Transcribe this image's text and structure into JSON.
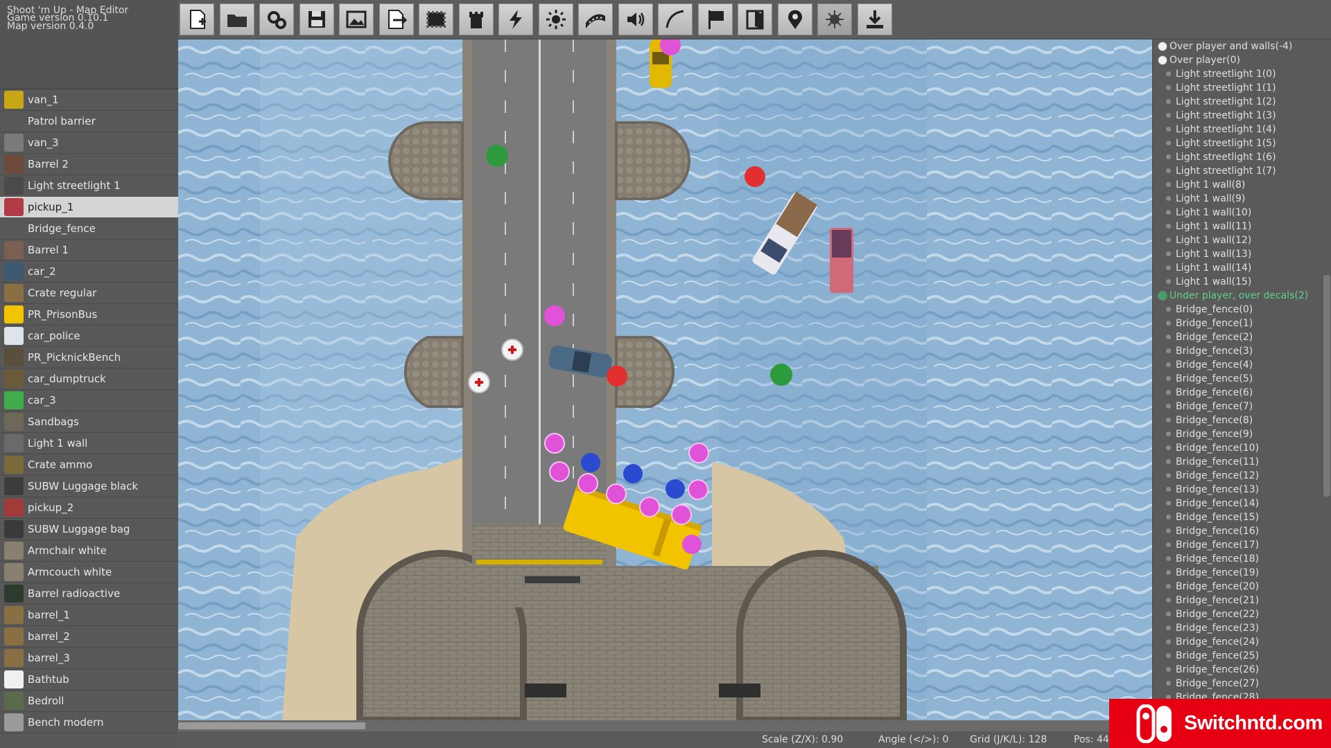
{
  "info": {
    "title": "Shoot 'm Up - Map Editor",
    "game_version": "Game version 0.10.1",
    "map_version": "Map version 0.4.0"
  },
  "toolbar": {
    "buttons": [
      {
        "name": "new-map",
        "icon": "new-file-icon"
      },
      {
        "name": "open-map",
        "icon": "folder-icon"
      },
      {
        "name": "settings",
        "icon": "gears-icon"
      },
      {
        "name": "save-map",
        "icon": "floppy-icon"
      },
      {
        "name": "background-image",
        "icon": "image-icon"
      },
      {
        "name": "export",
        "icon": "export-icon"
      },
      {
        "name": "stamp-tool",
        "icon": "stamp-icon"
      },
      {
        "name": "tower-tool",
        "icon": "tower-icon"
      },
      {
        "name": "lightning-tool",
        "icon": "lightning-icon"
      },
      {
        "name": "light-tool",
        "icon": "sun-icon"
      },
      {
        "name": "path-tool",
        "icon": "road-icon"
      },
      {
        "name": "sound-tool",
        "icon": "speaker-icon"
      },
      {
        "name": "curve-tool",
        "icon": "curve-icon"
      },
      {
        "name": "flag-tool",
        "icon": "flag-icon"
      },
      {
        "name": "door-tool",
        "icon": "door-icon"
      },
      {
        "name": "waypoint-tool",
        "icon": "map-pin-icon"
      },
      {
        "name": "effect-tool",
        "icon": "splat-icon"
      },
      {
        "name": "import-tool",
        "icon": "download-icon"
      }
    ]
  },
  "objects": [
    {
      "label": "van_1",
      "color": "#c9a616"
    },
    {
      "label": "Patrol barrier",
      "color": "#585858"
    },
    {
      "label": "van_3",
      "color": "#7a7a7a"
    },
    {
      "label": "Barrel 2",
      "color": "#6e4a3c"
    },
    {
      "label": "Light streetlight 1",
      "color": "#4a4a4a"
    },
    {
      "label": "pickup_1",
      "color": "#b13c48",
      "selected": true
    },
    {
      "label": "Bridge_fence",
      "color": "#585858"
    },
    {
      "label": "Barrel 1",
      "color": "#7a5f52"
    },
    {
      "label": "car_2",
      "color": "#3c5a72"
    },
    {
      "label": "Crate regular",
      "color": "#8a6f45"
    },
    {
      "label": "PR_PrisonBus",
      "color": "#f2c400"
    },
    {
      "label": "car_police",
      "color": "#dfe3ea"
    },
    {
      "label": "PR_PicknickBench",
      "color": "#5a4e3c"
    },
    {
      "label": "car_dumptruck",
      "color": "#6a5a3a"
    },
    {
      "label": "car_3",
      "color": "#3fae4a"
    },
    {
      "label": "Sandbags",
      "color": "#6e6858"
    },
    {
      "label": "Light 1 wall",
      "color": "#6a6a6a"
    },
    {
      "label": "Crate ammo",
      "color": "#7a6a3a"
    },
    {
      "label": "SUBW Luggage black",
      "color": "#3c3c3c"
    },
    {
      "label": "pickup_2",
      "color": "#a33a3a"
    },
    {
      "label": "SUBW Luggage bag",
      "color": "#3a3a3a"
    },
    {
      "label": "Armchair white",
      "color": "#8a8070"
    },
    {
      "label": "Armcouch white",
      "color": "#8a8070"
    },
    {
      "label": "Barrel radioactive",
      "color": "#2e3a2e"
    },
    {
      "label": "barrel_1",
      "color": "#8a6f45"
    },
    {
      "label": "barrel_2",
      "color": "#8a6f45"
    },
    {
      "label": "barrel_3",
      "color": "#8a6f45"
    },
    {
      "label": "Bathtub",
      "color": "#f0f0f0"
    },
    {
      "label": "Bedroll",
      "color": "#5a6a4a"
    },
    {
      "label": "Bench modern",
      "color": "#9a9a9a"
    }
  ],
  "layers": {
    "groups": [
      {
        "label": "Over player and walls(-4)",
        "marker": "white"
      },
      {
        "label": "Over player(0)",
        "marker": "white"
      }
    ],
    "over_player_items": [
      "Light streetlight 1(0)",
      "Light streetlight 1(1)",
      "Light streetlight 1(2)",
      "Light streetlight 1(3)",
      "Light streetlight 1(4)",
      "Light streetlight 1(5)",
      "Light streetlight 1(6)",
      "Light streetlight 1(7)",
      "Light 1 wall(8)",
      "Light 1 wall(9)",
      "Light 1 wall(10)",
      "Light 1 wall(11)",
      "Light 1 wall(12)",
      "Light 1 wall(13)",
      "Light 1 wall(14)",
      "Light 1 wall(15)"
    ],
    "under_group": {
      "label": "Under player, over decals(2)",
      "marker": "green"
    },
    "under_items": [
      "Bridge_fence(0)",
      "Bridge_fence(1)",
      "Bridge_fence(2)",
      "Bridge_fence(3)",
      "Bridge_fence(4)",
      "Bridge_fence(5)",
      "Bridge_fence(6)",
      "Bridge_fence(7)",
      "Bridge_fence(8)",
      "Bridge_fence(9)",
      "Bridge_fence(10)",
      "Bridge_fence(11)",
      "Bridge_fence(12)",
      "Bridge_fence(13)",
      "Bridge_fence(14)",
      "Bridge_fence(15)",
      "Bridge_fence(16)",
      "Bridge_fence(17)",
      "Bridge_fence(18)",
      "Bridge_fence(19)",
      "Bridge_fence(20)",
      "Bridge_fence(21)",
      "Bridge_fence(22)",
      "Bridge_fence(23)",
      "Bridge_fence(24)",
      "Bridge_fence(25)",
      "Bridge_fence(26)",
      "Bridge_fence(27)",
      "Bridge_fence(28)"
    ]
  },
  "status": {
    "scale": "Scale (Z/X): 0.90",
    "angle": "Angle (</>): 0",
    "grid": "Grid (J/K/L): 128",
    "pos": "Pos: 44"
  },
  "badge": {
    "text": "Switchntd.com",
    "color": "#e60012"
  },
  "colors": {
    "water": "#8fb4d4",
    "road": "#7a7a7a",
    "stone": "#8a8378",
    "sand": "#d6c6a4",
    "bus": "#f2c400",
    "pickup_pink": "#e052d8"
  }
}
